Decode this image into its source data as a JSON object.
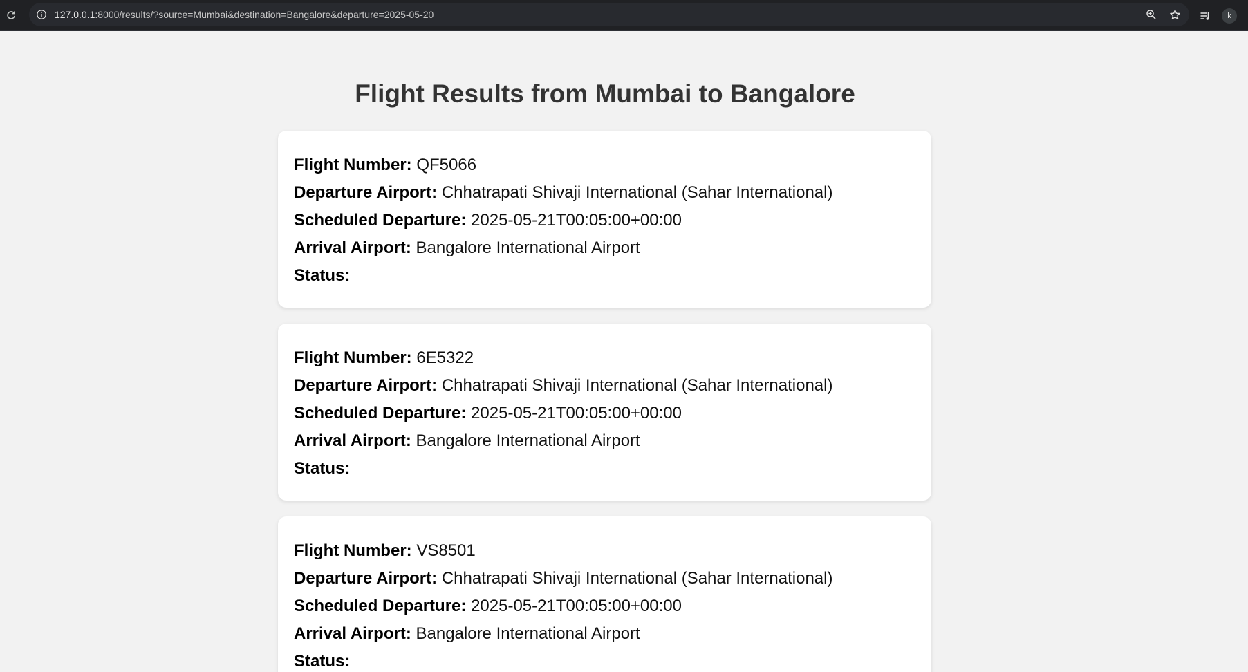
{
  "browser": {
    "url_host": "127.0.0.1",
    "url_rest": ":8000/results/?source=Mumbai&destination=Bangalore&departure=2025-05-20",
    "profile_initial": "k",
    "icons": [
      "reload-icon",
      "site-info-icon",
      "zoom-icon",
      "bookmark-star-icon",
      "reading-list-icon",
      "profile-avatar"
    ]
  },
  "page": {
    "title": "Flight Results from Mumbai to Bangalore"
  },
  "labels": {
    "flight_number": "Flight Number:",
    "departure_airport": "Departure Airport:",
    "scheduled_departure": "Scheduled Departure:",
    "arrival_airport": "Arrival Airport:",
    "status": "Status:"
  },
  "flights": [
    {
      "flight_number": "QF5066",
      "departure_airport": "Chhatrapati Shivaji International (Sahar International)",
      "scheduled_departure": "2025-05-21T00:05:00+00:00",
      "arrival_airport": "Bangalore International Airport",
      "status": ""
    },
    {
      "flight_number": "6E5322",
      "departure_airport": "Chhatrapati Shivaji International (Sahar International)",
      "scheduled_departure": "2025-05-21T00:05:00+00:00",
      "arrival_airport": "Bangalore International Airport",
      "status": ""
    },
    {
      "flight_number": "VS8501",
      "departure_airport": "Chhatrapati Shivaji International (Sahar International)",
      "scheduled_departure": "2025-05-21T00:05:00+00:00",
      "arrival_airport": "Bangalore International Airport",
      "status": ""
    }
  ],
  "colors": {
    "page_background": "#f2f2f2",
    "card_background": "#ffffff",
    "title_color": "#333333",
    "browser_chrome": "#202124"
  }
}
